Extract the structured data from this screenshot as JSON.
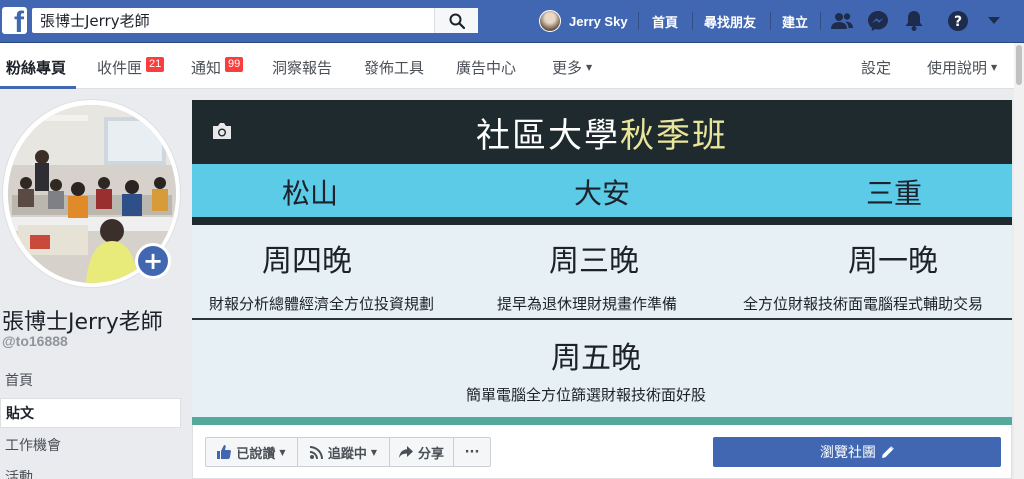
{
  "topbar": {
    "logo": "f",
    "search_value": "張博士Jerry老師",
    "user_name": "Jerry Sky",
    "nav": [
      "首頁",
      "尋找朋友",
      "建立"
    ]
  },
  "tabs": {
    "items": [
      {
        "label": "粉絲專頁"
      },
      {
        "label": "收件匣",
        "badge": "21"
      },
      {
        "label": "通知",
        "badge": "99"
      },
      {
        "label": "洞察報告"
      },
      {
        "label": "發佈工具"
      },
      {
        "label": "廣告中心"
      },
      {
        "label": "更多"
      }
    ],
    "settings": "設定",
    "help": "使用說明"
  },
  "page": {
    "name": "張博士Jerry老師",
    "handle": "@to16888"
  },
  "sidebar": {
    "items": [
      "首頁",
      "貼文",
      "工作機會",
      "活動"
    ]
  },
  "cover": {
    "title_main": "社區大學",
    "title_highlight": "秋季班",
    "locations": [
      "松山",
      "大安",
      "三重"
    ],
    "sessions": [
      {
        "day": "周四晚",
        "desc": "財報分析總體經濟全方位投資規劃"
      },
      {
        "day": "周三晚",
        "desc": "提早為退休理財規畫作準備"
      },
      {
        "day": "周一晚",
        "desc": "全方位財報技術面電腦程式輔助交易"
      },
      {
        "day": "周五晚",
        "desc": "簡單電腦全方位篩選財報技術面好股"
      }
    ]
  },
  "actions": {
    "liked": "已說讚",
    "following": "追蹤中",
    "share": "分享",
    "more": "···",
    "primary": "瀏覽社團"
  },
  "colors": {
    "brand": "#4267b2",
    "cover_dark": "#1e2a2e",
    "cover_band": "#5bcbe8",
    "title_highlight": "#e9e59a",
    "badge": "#fa3e3e"
  }
}
